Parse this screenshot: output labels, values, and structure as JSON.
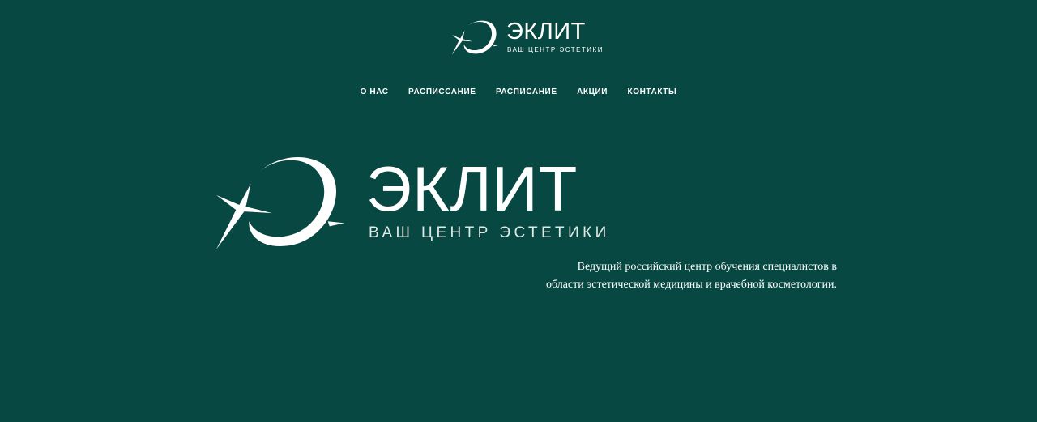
{
  "header": {
    "logo": {
      "icon": "crescent-star-icon",
      "brand": "ЭКЛИТ",
      "tagline": "ВАШ ЦЕНТР ЭСТЕТИКИ"
    }
  },
  "nav": {
    "items": [
      {
        "label": "О НАС"
      },
      {
        "label": "РАСПИССАНИЕ"
      },
      {
        "label": "РАСПИСАНИЕ"
      },
      {
        "label": "АКЦИИ"
      },
      {
        "label": "КОНТАКТЫ"
      }
    ]
  },
  "hero": {
    "logo": {
      "icon": "crescent-star-icon",
      "brand": "ЭКЛИТ",
      "tagline": "ВАШ ЦЕНТР ЭСТЕТИКИ"
    },
    "description": {
      "line1": "Ведущий российский центр обучения специалистов в",
      "line2": "области эстетической медицины и врачебной косметологии."
    }
  },
  "colors": {
    "background": "#084842",
    "text": "#ffffff"
  }
}
